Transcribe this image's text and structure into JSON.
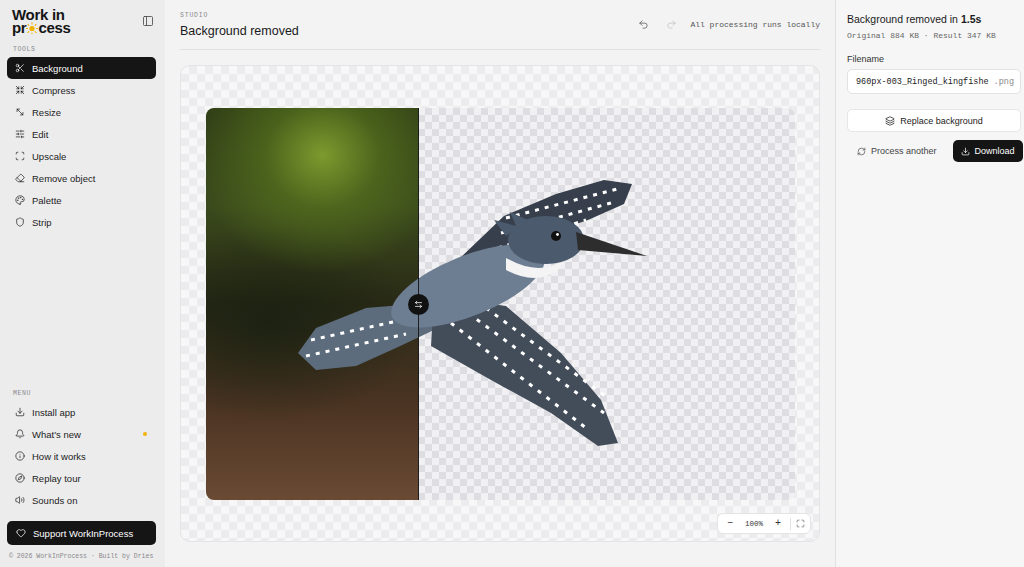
{
  "logo": {
    "top": "Work in",
    "bottom_start": "pr",
    "bottom_end": "cess"
  },
  "sidebar": {
    "tools_heading": "TOOLS",
    "tools": [
      {
        "label": "Background",
        "selected": true
      },
      {
        "label": "Compress",
        "selected": false
      },
      {
        "label": "Resize",
        "selected": false
      },
      {
        "label": "Edit",
        "selected": false
      },
      {
        "label": "Upscale",
        "selected": false
      },
      {
        "label": "Remove object",
        "selected": false
      },
      {
        "label": "Palette",
        "selected": false
      },
      {
        "label": "Strip",
        "selected": false
      }
    ],
    "menu_heading": "MENU",
    "menu": [
      {
        "label": "Install app",
        "badge": false
      },
      {
        "label": "What's new",
        "badge": true
      },
      {
        "label": "How it works",
        "badge": false
      },
      {
        "label": "Replay tour",
        "badge": false
      },
      {
        "label": "Sounds on",
        "badge": false
      }
    ],
    "support": "Support WorkInProcess",
    "footer": "© 2026 WorkInProcess · Built by Dries"
  },
  "header": {
    "eyebrow": "STUDIO",
    "title": "Background removed",
    "undo_enabled": true,
    "redo_enabled": false,
    "note": "All processing runs locally"
  },
  "comparison": {
    "level": 0.36
  },
  "zoom": {
    "minus": "−",
    "value": "100%",
    "plus": "+"
  },
  "result": {
    "status": "Background removed in",
    "time": "1.5s",
    "sizes": "Original 884 KB · Result 347 KB",
    "filename_label": "Filename",
    "filename": "960px-003_Ringed_kingfishe",
    "extension": ".png",
    "replace": "Replace background",
    "process_another": "Process another",
    "download": "Download"
  }
}
